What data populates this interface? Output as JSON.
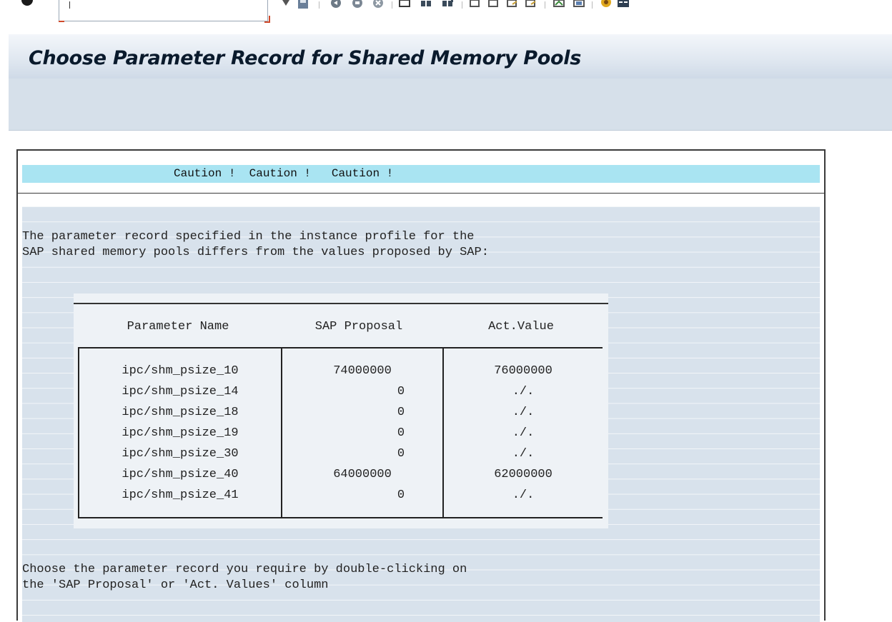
{
  "title": "Choose Parameter Record for Shared Memory Pools",
  "command_field": {
    "value": ""
  },
  "toolbar": {
    "icons": [
      "enter-icon",
      "save-icon",
      "back-icon",
      "exit-icon",
      "cancel-icon",
      "print-icon",
      "find-icon",
      "find-next-icon",
      "first-page-icon",
      "previous-page-icon",
      "next-page-icon",
      "last-page-icon",
      "new-session-icon",
      "shortcut-icon",
      "help-icon",
      "layout-icon"
    ]
  },
  "caution_banner": "Caution !  Caution !   Caution !",
  "intro_lines": [
    "The parameter record specified in the instance profile for the",
    "SAP shared memory pools differs from the values proposed by SAP:"
  ],
  "table": {
    "headers": [
      "Parameter Name",
      "SAP Proposal",
      "Act.Value"
    ],
    "rows": [
      [
        "ipc/shm_psize_10",
        "74000000",
        "76000000"
      ],
      [
        "ipc/shm_psize_14",
        "0",
        "./."
      ],
      [
        "ipc/shm_psize_18",
        "0",
        "./."
      ],
      [
        "ipc/shm_psize_19",
        "0",
        "./."
      ],
      [
        "ipc/shm_psize_30",
        "0",
        "./."
      ],
      [
        "ipc/shm_psize_40",
        "64000000",
        "62000000"
      ],
      [
        "ipc/shm_psize_41",
        "0",
        "./."
      ]
    ]
  },
  "footer_lines": [
    "Choose the parameter record you require by double-clicking on",
    "the 'SAP Proposal' or 'Act. Values' column"
  ]
}
